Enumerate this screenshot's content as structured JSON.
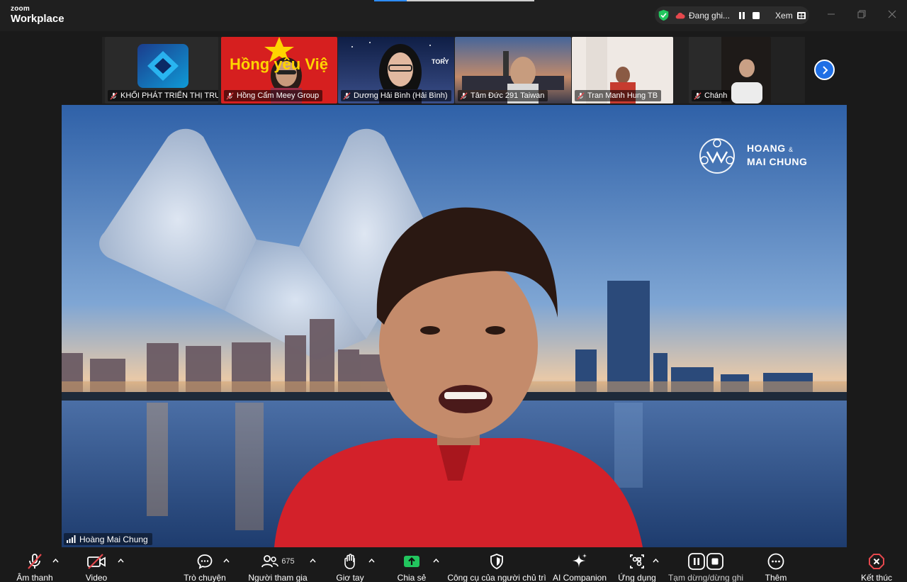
{
  "window": {
    "brand_top": "zoom",
    "brand_bottom": "Workplace"
  },
  "recording": {
    "status": "Đang ghi...",
    "view_label": "Xem"
  },
  "gallery": {
    "participants": [
      {
        "name": "KHỐI PHÁT TRIỂN THỊ TRƯ...",
        "muted": true
      },
      {
        "name": "Hồng Cẩm Meey Group",
        "muted": true
      },
      {
        "name": "Dương Hải Bình (Hải Bình)",
        "muted": true
      },
      {
        "name": "Tâm Đức 291 Taiwan",
        "muted": true
      },
      {
        "name": "Tran Manh Hung TB",
        "muted": true
      },
      {
        "name": "Chánh",
        "muted": true
      }
    ],
    "tile_banner_text": "Hồng  yêu Việ",
    "tile3_badge": "TORY"
  },
  "main": {
    "speaker_name": "Hoàng Mai Chung",
    "logo_line1": "HOANG",
    "logo_amp": "&",
    "logo_line2": "MAI CHUNG"
  },
  "toolbar": {
    "audio": "Âm thanh",
    "video": "Video",
    "chat": "Trò chuyện",
    "participants": "Người tham gia",
    "participant_count": "675",
    "raise_hand": "Giơ tay",
    "share": "Chia sẻ",
    "host_tools": "Công cụ của người chủ trì",
    "ai_companion": "AI Companion",
    "apps": "Ứng dụng",
    "pause_recording": "Tạm dừng/dừng ghi",
    "more": "Thêm",
    "end": "Kết thúc"
  },
  "colors": {
    "accent_blue": "#1f6fe5",
    "share_green": "#22c55e",
    "end_red": "#e5484d",
    "mute_red": "#e5484d"
  }
}
